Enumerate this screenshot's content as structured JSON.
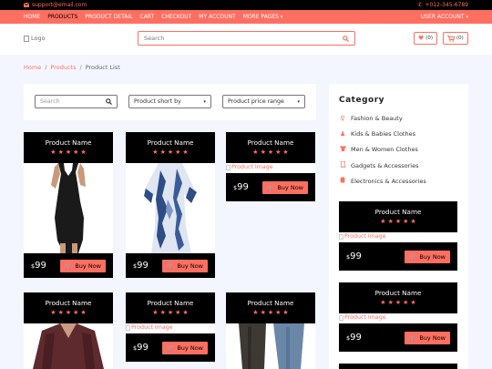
{
  "topbar": {
    "email": "support@email.com",
    "phone": "+012-345-6789"
  },
  "nav": {
    "items": [
      "HOME",
      "PRODUCTS",
      "PRODUCT DETAIL",
      "CART",
      "CHECKOUT",
      "MY ACCOUNT",
      "MORE PAGES"
    ],
    "active": "PRODUCTS",
    "account": "USER ACCOUNT"
  },
  "header": {
    "logo_alt": "Logo",
    "search_placeholder": "Search",
    "wishlist_count": "(0)",
    "cart_count": "(0)"
  },
  "breadcrumb": {
    "home": "Home",
    "products": "Products",
    "current": "Product List"
  },
  "filters": {
    "search_placeholder": "Search",
    "sort_label": "Product short by",
    "price_label": "Product price range"
  },
  "products": [
    {
      "name": "Product Name",
      "currency": "$",
      "price": "99",
      "buy": "Buy Now",
      "rating": 5
    },
    {
      "name": "Product Name",
      "currency": "$",
      "price": "99",
      "buy": "Buy Now",
      "rating": 5
    },
    {
      "name": "Product Name",
      "currency": "$",
      "price": "99",
      "buy": "Buy Now",
      "rating": 5,
      "image_alt": "Product Image"
    },
    {
      "name": "Product Name",
      "rating": 5
    },
    {
      "name": "Product Name",
      "currency": "$",
      "price": "99",
      "buy": "Buy Now",
      "rating": 5,
      "image_alt": "Product Image"
    },
    {
      "name": "Product Name",
      "rating": 5
    }
  ],
  "sidebar": {
    "title": "Category",
    "categories": [
      {
        "label": "Fashion & Beauty",
        "icon": "female-icon"
      },
      {
        "label": "Kids & Babies Clothes",
        "icon": "child-icon"
      },
      {
        "label": "Men & Women Clothes",
        "icon": "shirt-icon"
      },
      {
        "label": "Gadgets & Accessories",
        "icon": "mobile-icon"
      },
      {
        "label": "Electronics & Accessories",
        "icon": "microchip-icon"
      }
    ],
    "products": [
      {
        "name": "Product Name",
        "image_alt": "Product Image",
        "currency": "$",
        "price": "99",
        "buy": "Buy Now",
        "rating": 5
      },
      {
        "name": "Product Name",
        "image_alt": "Product Image",
        "currency": "$",
        "price": "99",
        "buy": "Buy Now",
        "rating": 5
      }
    ]
  },
  "colors": {
    "accent": "#ff6f61",
    "dark": "#000000",
    "page_bg": "#f3f6ff"
  }
}
